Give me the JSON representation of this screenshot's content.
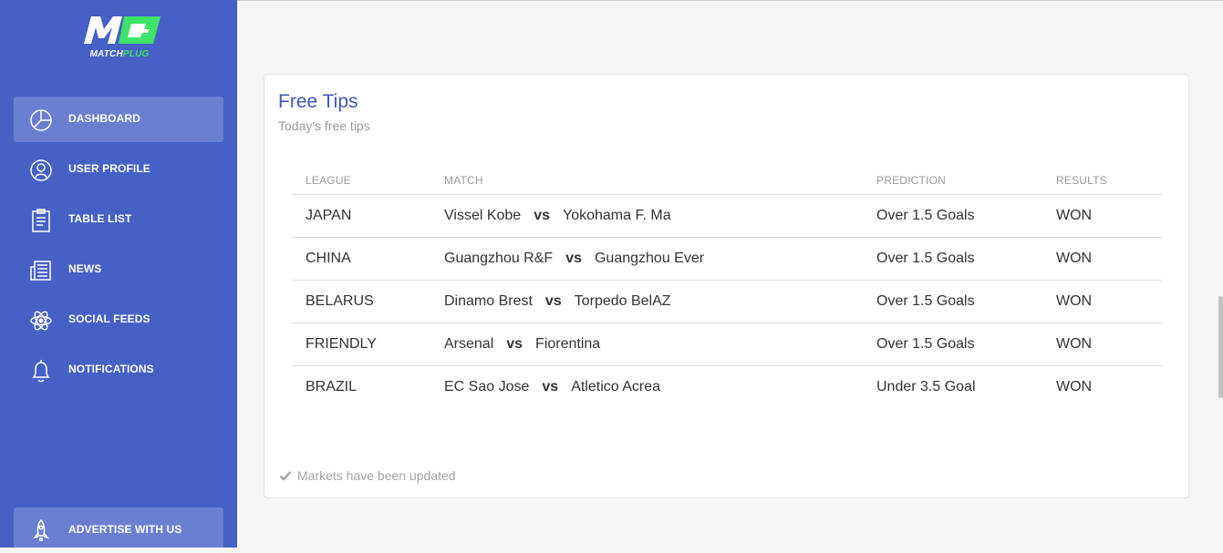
{
  "logo": {
    "mark": "M",
    "text_main": "MATCH",
    "text_accent": "PLUG"
  },
  "sidebar": {
    "items": [
      {
        "label": "DASHBOARD",
        "icon": "pie-chart-icon"
      },
      {
        "label": "USER PROFILE",
        "icon": "user-icon"
      },
      {
        "label": "TABLE LIST",
        "icon": "clipboard-icon"
      },
      {
        "label": "NEWS",
        "icon": "newspaper-icon"
      },
      {
        "label": "SOCIAL FEEDS",
        "icon": "atom-icon"
      },
      {
        "label": "NOTIFICATIONS",
        "icon": "bell-icon"
      }
    ],
    "bottom": {
      "label": "ADVERTISE WITH US",
      "icon": "rocket-icon"
    }
  },
  "card": {
    "title": "Free Tips",
    "subtitle": "Today's free tips",
    "columns": [
      "LEAGUE",
      "MATCH",
      "PREDICTION",
      "RESULTS"
    ],
    "rows": [
      {
        "league": "JAPAN",
        "home": "Vissel Kobe",
        "vs": "vs",
        "away": "Yokohama F. Ma",
        "prediction": "Over 1.5 Goals",
        "result": "WON"
      },
      {
        "league": "CHINA",
        "home": "Guangzhou R&F",
        "vs": "vs",
        "away": "Guangzhou Ever",
        "prediction": "Over 1.5 Goals",
        "result": "WON"
      },
      {
        "league": "BELARUS",
        "home": "Dinamo Brest",
        "vs": "vs",
        "away": "Torpedo BelAZ",
        "prediction": "Over 1.5 Goals",
        "result": "WON"
      },
      {
        "league": "FRIENDLY",
        "home": "Arsenal",
        "vs": "vs",
        "away": "Fiorentina",
        "prediction": "Over 1.5 Goals",
        "result": "WON"
      },
      {
        "league": "BRAZIL",
        "home": "EC Sao Jose",
        "vs": "vs",
        "away": "Atletico Acrea",
        "prediction": "Under 3.5 Goal",
        "result": "WON"
      }
    ],
    "footer": "Markets have been updated"
  },
  "colors": {
    "sidebar": "#4660c6",
    "title": "#3f56b6",
    "logo_accent": "#3ee36a"
  }
}
